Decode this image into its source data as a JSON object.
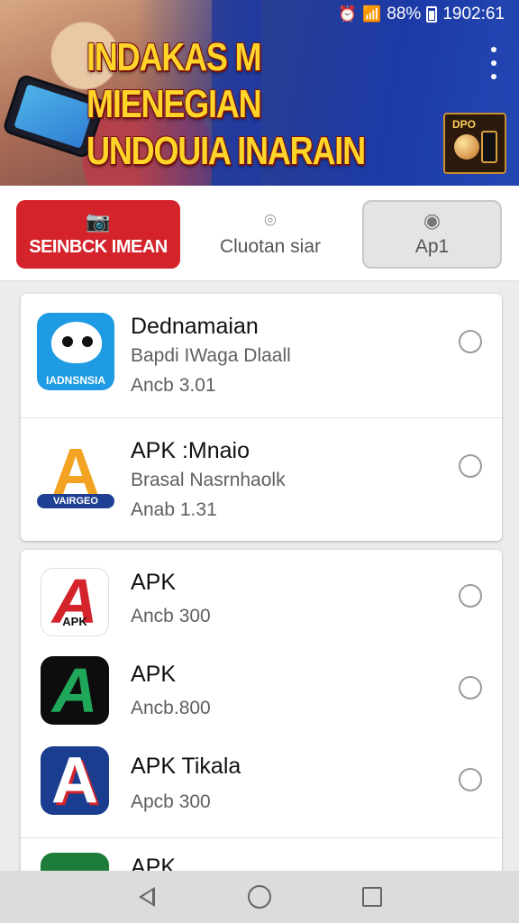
{
  "status_bar": {
    "battery": "88%",
    "time": "1902:61"
  },
  "banner": {
    "title_part1": "INDAKAS M ",
    "title_part2": "MIENEGIAN",
    "title_line2": "UNDOUIA INARAIN",
    "promo_label": "DPO"
  },
  "tabs": [
    {
      "label": "SEINBCK IMEAN",
      "icon": "camera-icon",
      "active": true
    },
    {
      "label": "Cluotan siar",
      "icon": "camera-outline-icon",
      "active": false
    },
    {
      "label": "Ap1",
      "icon": "user-icon",
      "active": false
    }
  ],
  "apps_group1": [
    {
      "name": "Dednamaian",
      "sub1": "Bapdi IWaga Dlaall",
      "sub2": "Ancb 3.01",
      "icon_tag": "IADNSNSIA"
    },
    {
      "name": "APK :Mnaio",
      "sub1": "Brasal  Nasrnhaolk",
      "sub2": "Anab 1.31",
      "icon_tag": "VAIRGEO"
    }
  ],
  "apps_group2": [
    {
      "name": "APK",
      "sub2": "Ancb 300",
      "icon_tag": "APK"
    },
    {
      "name": "APK",
      "sub2": "Ancb.800"
    },
    {
      "name": "APK Tikala",
      "sub2": "Apcb 300"
    },
    {
      "name": "APK"
    }
  ],
  "colors": {
    "accent_red": "#d4232b",
    "banner_blue": "#1c3aa8",
    "title_yellow": "#ffd52a"
  }
}
